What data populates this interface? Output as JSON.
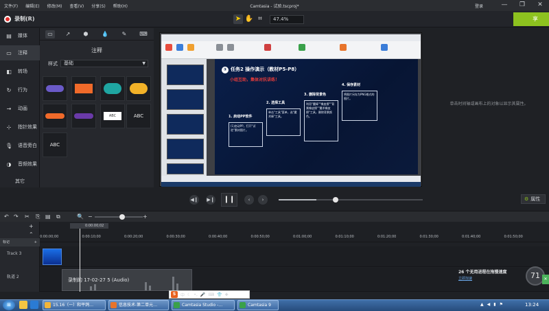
{
  "menubar": {
    "items": [
      "文件(F)",
      "编辑(E)",
      "修改(M)",
      "查看(V)",
      "分享(S)",
      "帮助(H)"
    ],
    "title": "Camtasia - 试验.tscproj*",
    "login": "登录",
    "window_buttons": [
      "—",
      "❐",
      "✕"
    ]
  },
  "toolbar": {
    "record_label": "录制(R)",
    "zoom_value": "47.4%",
    "share_label": "享"
  },
  "sidebar": {
    "items": [
      {
        "label": "媒体",
        "icon": "media-icon"
      },
      {
        "label": "注释",
        "icon": "annotation-icon"
      },
      {
        "label": "转场",
        "icon": "transition-icon"
      },
      {
        "label": "行为",
        "icon": "behavior-icon"
      },
      {
        "label": "动画",
        "icon": "animation-icon"
      },
      {
        "label": "指针效果",
        "icon": "cursor-effect-icon"
      },
      {
        "label": "语音旁白",
        "icon": "voice-narration-icon"
      },
      {
        "label": "音频效果",
        "icon": "audio-effect-icon"
      }
    ],
    "more": "其它"
  },
  "panel": {
    "title": "注释",
    "style_label": "样式",
    "style_value": "基础",
    "abc": [
      "ABC",
      "ABC",
      "ABC",
      "ABC"
    ]
  },
  "slide": {
    "title": "任务2  操作演示（教材P5-P8）",
    "subtitle": "小组互助，集体对抗讲练！",
    "steps": [
      "1. 启动PP软件",
      "2. 选择工具",
      "3. 删除背景色",
      "4. 保存素材"
    ],
    "step_texts": [
      "(1)启动PP，打开\"试验\"素材图片。",
      "单击\"工具\"菜单，选\"魔术棒\"工具。",
      "利用\"魔棒\"\"橡皮擦\"\"背景橡皮擦\"\"魔术橡皮擦\"工具，删除背景颜色。",
      "将图片另存为PNG格式的图片。"
    ]
  },
  "canvas_hint": "单击时间轴或画布上的对象以显示其属性。",
  "playback": {
    "play_label": "❙❙",
    "progress": 0.26
  },
  "properties_label": "属性",
  "timeline": {
    "playhead_time": "0:00:00;02",
    "ticks": [
      "0:00:00;00",
      "0:00:10;00",
      "0:00:20;00",
      "0:00:30;00",
      "0:00:40;00",
      "0:00:50;00",
      "0:01:00;00",
      "0:01:10;00",
      "0:01:20;00",
      "0:01:30;00",
      "0:01:40;00",
      "0:01:50;00"
    ],
    "marker_label": "标记",
    "tracks": [
      "Track 3",
      "轨道 2"
    ],
    "audio_clip": "录制的 17-02-27 5 (Audio)"
  },
  "notification": {
    "text": "26 个无用进程在拖慢速度",
    "link": "立即加速",
    "badge": "71"
  },
  "ime": {
    "label": "中"
  },
  "taskbar": {
    "apps": [
      {
        "label": "15.16（一）和平鸽…",
        "color": "#f2b53a"
      },
      {
        "label": "信息技术-第二单元…",
        "color": "#e8742b"
      },
      {
        "label": "Camtasia Studio -…",
        "color": "#3aa14a"
      },
      {
        "label": "Camtasia 9",
        "color": "#3aa14a"
      }
    ],
    "clock": "13:24"
  }
}
